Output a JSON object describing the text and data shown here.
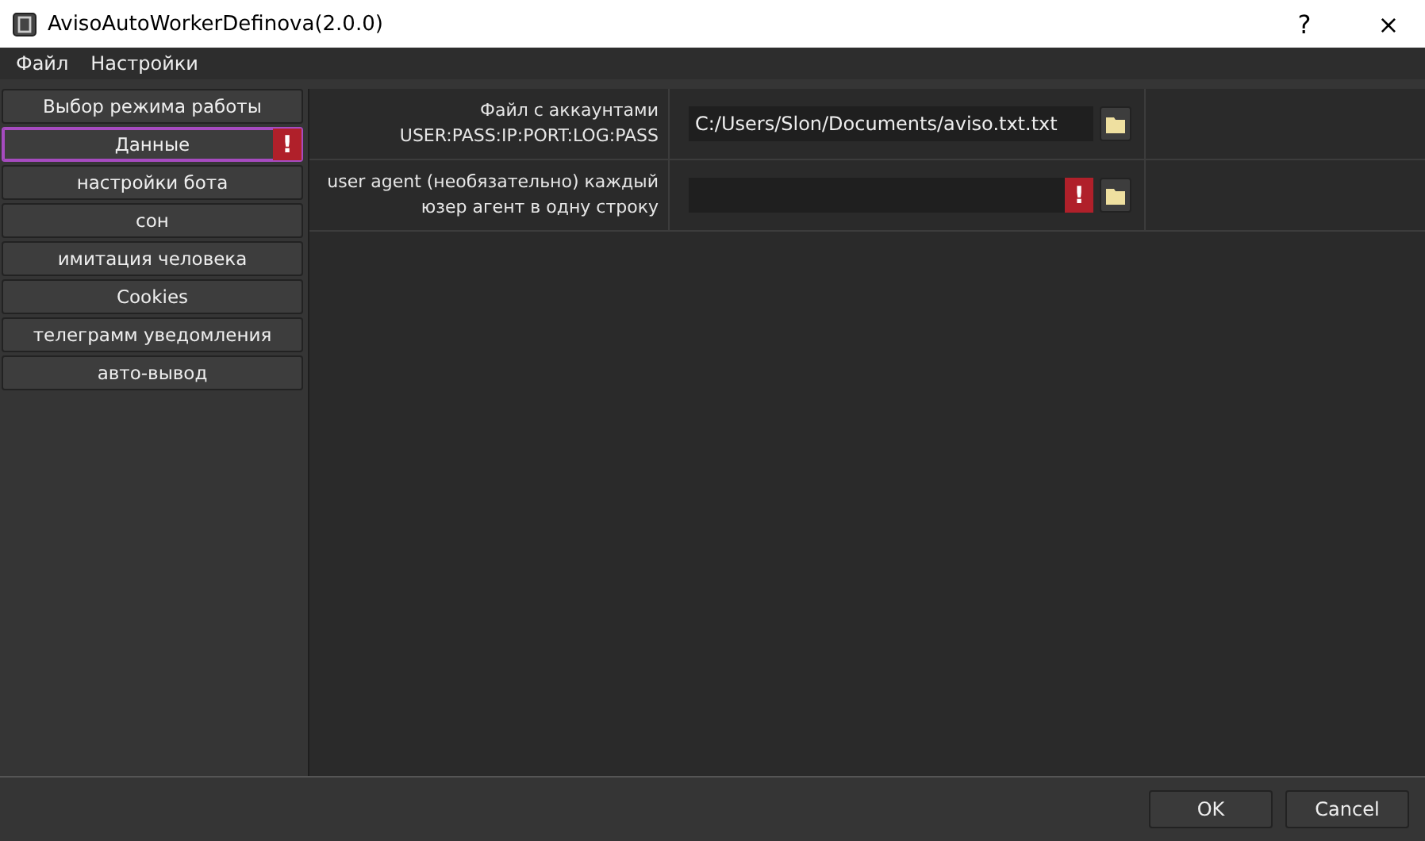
{
  "window": {
    "title": "AvisoAutoWorkerDefinova(2.0.0)",
    "help": "?",
    "close": "×"
  },
  "menu": [
    "Файл",
    "Настройки"
  ],
  "sidebar": {
    "items": [
      {
        "label": "Выбор режима работы",
        "selected": false,
        "warning": false
      },
      {
        "label": "Данные",
        "selected": true,
        "warning": true,
        "warning_mark": "!"
      },
      {
        "label": "настройки бота",
        "selected": false,
        "warning": false
      },
      {
        "label": "сон",
        "selected": false,
        "warning": false
      },
      {
        "label": "имитация человека",
        "selected": false,
        "warning": false
      },
      {
        "label": "Cookies",
        "selected": false,
        "warning": false
      },
      {
        "label": "телеграмм уведомления",
        "selected": false,
        "warning": false
      },
      {
        "label": "авто-вывод",
        "selected": false,
        "warning": false
      }
    ]
  },
  "fields": [
    {
      "label": "Файл с аккаунтами USER:PASS:IP:PORT:LOG:PASS",
      "value": "C:/Users/Slon/Documents/aviso.txt.txt",
      "warning": false
    },
    {
      "label": "user agent (необязательно) каждый юзер агент в одну строку",
      "warning": true,
      "warning_mark": "!"
    }
  ],
  "buttons": [
    "OK",
    "Cancel"
  ]
}
